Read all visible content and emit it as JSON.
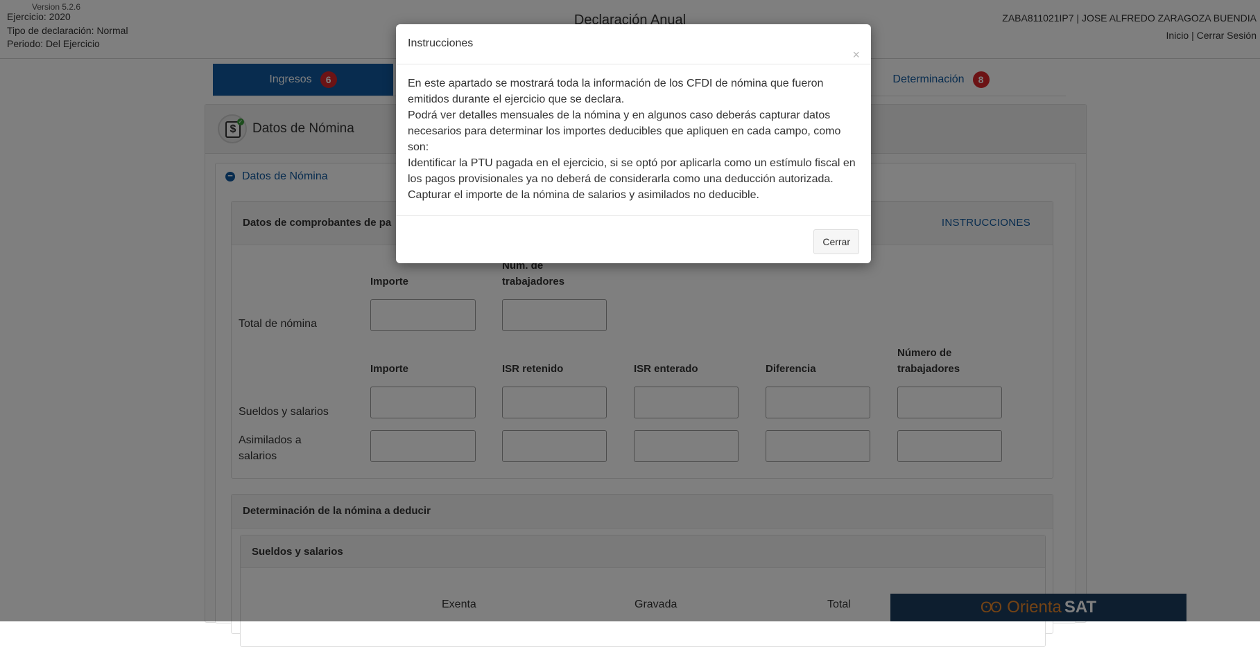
{
  "header": {
    "version": "Version 5.2.6",
    "ejercicio": "Ejercicio: 2020",
    "tipo": "Tipo de declaración: Normal",
    "periodo": "Periodo: Del Ejercicio",
    "title": "Declaración Anual",
    "user": "ZABA811021IP7 | JOSE ALFREDO ZARAGOZA BUENDIA",
    "inicio": "Inicio",
    "separator": "|",
    "cerrar_sesion": "Cerrar Sesión"
  },
  "tabs": [
    {
      "label": "Ingresos",
      "badge": "6"
    },
    {
      "label": "Determinación",
      "badge": "8"
    }
  ],
  "panel": {
    "title": "Datos de Nómina",
    "section_title": "Datos de Nómina",
    "minus_icon": "−",
    "money_icon": "$",
    "check_icon": "✓"
  },
  "comprobantes": {
    "title": "Datos de comprobantes de pa",
    "instructions_link": "INSTRUCCIONES",
    "total_cols": [
      "Importe",
      "Núm. de trabajadores"
    ],
    "total_row": "Total de nómina",
    "cols": [
      "Importe",
      "ISR retenido",
      "ISR enterado",
      "Diferencia",
      "Número de trabajadores"
    ],
    "rows": [
      "Sueldos y salarios",
      "Asimilados a salarios"
    ]
  },
  "determinacion": {
    "title": "Determinación de la nómina a deducir",
    "sub_title": "Sueldos y salarios",
    "cols": [
      "Exenta",
      "Gravada",
      "Total"
    ]
  },
  "modal": {
    "title": "Instrucciones",
    "close_icon": "×",
    "paragraphs": [
      "En este apartado se mostrará toda la información de los CFDI de nómina que fueron emitidos durante el ejercicio que se declara.",
      "Podrá ver detalles mensuales de la nómina y en algunos caso deberás capturar datos necesarios para determinar los importes deducibles que apliquen en cada campo, como son:",
      "Identificar la PTU pagada en el ejercicio, si se optó por aplicarla como un estímulo fiscal en los pagos provisionales ya no deberá de considerarla como una deducción autorizada.",
      "Capturar el importe de la nómina de salarios y asimilados no deducible."
    ],
    "close_button": "Cerrar"
  },
  "orientasat": {
    "owl_icon": "ʘʘ",
    "part1": "Orienta",
    "part2": "SAT"
  },
  "colors": {
    "primary": "#10599e",
    "badge": "#d9262a",
    "overlay": "rgba(0,0,0,0.5)",
    "orienta_bg": "#1b3c5e",
    "orienta_accent": "#e8862a"
  }
}
